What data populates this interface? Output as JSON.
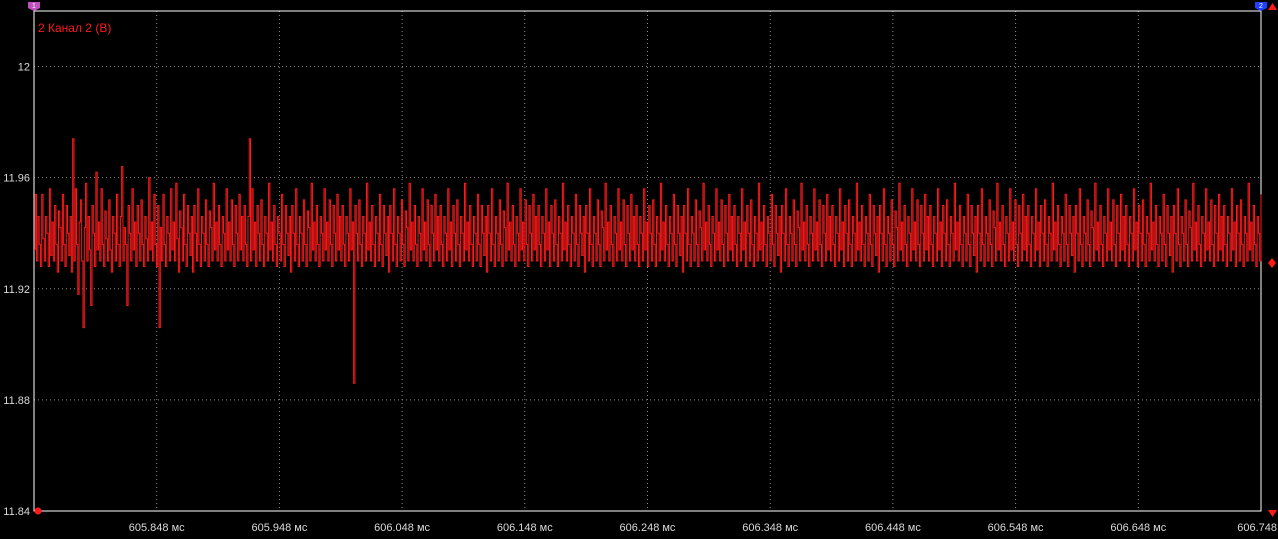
{
  "colors": {
    "background": "#000000",
    "frame": "#ffffff",
    "grid": "#8a8a8a",
    "trace": "#ff1a1a",
    "marker_1": "#c050c0",
    "marker_2": "#2040ff",
    "axis_text": "#d9d9d9"
  },
  "markers": {
    "left_label": "1",
    "right_label": "2",
    "left_icon": "marker-flag-icon",
    "right_icon": "marker-flag-icon",
    "range_up_icon": "triangle-up-icon",
    "range_down_icon": "triangle-down-icon",
    "level_icon": "diamond-icon",
    "zero_icon": "circle-icon"
  },
  "chart_data": {
    "type": "line",
    "title": "2 Канал 2 (В)",
    "xlabel": "",
    "ylabel": "",
    "x_unit": "мс",
    "xlim": [
      605.748,
      606.748
    ],
    "ylim": [
      11.84,
      12.02
    ],
    "grid": true,
    "y_ticks": [
      {
        "value": 11.84,
        "label": "11.84"
      },
      {
        "value": 11.88,
        "label": "11.88"
      },
      {
        "value": 11.92,
        "label": "11.92"
      },
      {
        "value": 11.96,
        "label": "11.96"
      },
      {
        "value": 12.0,
        "label": "12"
      }
    ],
    "x_ticks": [
      {
        "value": 605.848,
        "label": "605.848 мс"
      },
      {
        "value": 605.948,
        "label": "605.948 мс"
      },
      {
        "value": 606.048,
        "label": "606.048 мс"
      },
      {
        "value": 606.148,
        "label": "606.148 мс"
      },
      {
        "value": 606.248,
        "label": "606.248 мс"
      },
      {
        "value": 606.348,
        "label": "606.348 мс"
      },
      {
        "value": 606.448,
        "label": "606.448 мс"
      },
      {
        "value": 606.548,
        "label": "606.548 мс"
      },
      {
        "value": 606.648,
        "label": "606.648 мс"
      },
      {
        "value": 606.748,
        "label": "606.748"
      }
    ],
    "series": [
      {
        "name": "2 Канал 2 (В)",
        "color": "#ff1a1a",
        "x_start": 605.748,
        "x_end": 606.748,
        "quantization_step": 0.002,
        "min": 11.886,
        "max": 11.974,
        "mean": 11.94,
        "values": [
          11.934,
          11.954,
          11.93,
          11.946,
          11.936,
          11.928,
          11.954,
          11.938,
          11.93,
          11.946,
          11.94,
          11.928,
          11.956,
          11.932,
          11.944,
          11.93,
          11.95,
          11.936,
          11.926,
          11.948,
          11.942,
          11.93,
          11.954,
          11.936,
          11.928,
          11.95,
          11.94,
          11.932,
          11.946,
          11.926,
          11.974,
          11.93,
          11.956,
          11.936,
          11.918,
          11.944,
          11.952,
          11.93,
          11.906,
          11.942,
          11.958,
          11.93,
          11.946,
          11.934,
          11.914,
          11.95,
          11.94,
          11.928,
          11.962,
          11.934,
          11.944,
          11.93,
          11.956,
          11.936,
          11.928,
          11.948,
          11.938,
          11.93,
          11.952,
          11.934,
          11.926,
          11.946,
          11.94,
          11.93,
          11.954,
          11.936,
          11.928,
          11.946,
          11.964,
          11.93,
          11.942,
          11.936,
          11.914,
          11.95,
          11.94,
          11.93,
          11.956,
          11.934,
          11.944,
          11.928,
          11.95,
          11.94,
          11.93,
          11.952,
          11.936,
          11.928,
          11.946,
          11.938,
          11.93,
          11.96,
          11.934,
          11.944,
          11.93,
          11.954,
          11.936,
          11.928,
          11.95,
          11.906,
          11.942,
          11.93,
          11.954,
          11.936,
          11.928,
          11.946,
          11.94,
          11.93,
          11.956,
          11.934,
          11.944,
          11.93,
          11.958,
          11.938,
          11.926,
          11.948,
          11.942,
          11.93,
          11.954,
          11.936,
          11.928,
          11.95,
          11.94,
          11.932,
          11.946,
          11.926,
          11.95,
          11.94,
          11.93,
          11.956,
          11.936,
          11.928,
          11.946,
          11.94,
          11.93,
          11.952,
          11.936,
          11.928,
          11.948,
          11.942,
          11.93,
          11.958,
          11.934,
          11.944,
          11.93,
          11.95,
          11.936,
          11.928,
          11.946,
          11.94,
          11.93,
          11.956,
          11.934,
          11.944,
          11.93,
          11.952,
          11.936,
          11.928,
          11.95,
          11.94,
          11.93,
          11.954,
          11.934,
          11.946,
          11.93,
          11.95,
          11.936,
          11.928,
          11.946,
          11.974,
          11.93,
          11.956,
          11.934,
          11.944,
          11.928,
          11.95,
          11.94,
          11.93,
          11.952,
          11.936,
          11.928,
          11.946,
          11.94,
          11.93,
          11.958,
          11.934,
          11.944,
          11.93,
          11.95,
          11.936,
          11.928,
          11.946,
          11.94,
          11.93,
          11.954,
          11.936,
          11.928,
          11.95,
          11.94,
          11.932,
          11.946,
          11.926,
          11.95,
          11.94,
          11.93,
          11.956,
          11.936,
          11.928,
          11.946,
          11.94,
          11.93,
          11.952,
          11.936,
          11.928,
          11.948,
          11.942,
          11.93,
          11.958,
          11.934,
          11.944,
          11.93,
          11.95,
          11.936,
          11.928,
          11.946,
          11.94,
          11.93,
          11.956,
          11.934,
          11.944,
          11.93,
          11.952,
          11.936,
          11.928,
          11.95,
          11.94,
          11.93,
          11.954,
          11.934,
          11.946,
          11.93,
          11.95,
          11.936,
          11.928,
          11.946,
          11.94,
          11.93,
          11.956,
          11.934,
          11.944,
          11.928,
          11.95,
          11.94,
          11.93,
          11.952,
          11.936,
          11.928,
          11.946,
          11.94,
          11.93,
          11.958,
          11.934,
          11.944,
          11.93,
          11.95,
          11.936,
          11.928,
          11.946,
          11.94,
          11.93,
          11.954,
          11.936,
          11.928,
          11.95,
          11.94,
          11.932,
          11.946,
          11.926,
          11.95,
          11.94,
          11.93,
          11.956,
          11.936,
          11.928,
          11.946,
          11.94,
          11.93,
          11.952,
          11.936,
          11.928,
          11.948,
          11.942,
          11.93,
          11.958,
          11.934,
          11.944,
          11.93,
          11.95,
          11.936,
          11.928,
          11.946,
          11.94,
          11.93,
          11.956,
          11.934,
          11.944,
          11.93,
          11.952,
          11.936,
          11.928,
          11.95,
          11.94,
          11.93,
          11.954,
          11.934,
          11.946,
          11.93,
          11.95,
          11.936,
          11.928,
          11.946,
          11.94,
          11.93,
          11.956,
          11.934,
          11.944,
          11.928,
          11.95,
          11.94,
          11.93,
          11.952,
          11.936,
          11.928,
          11.946,
          11.94,
          11.93,
          11.958,
          11.934,
          11.944,
          11.93,
          11.95,
          11.936,
          11.928,
          11.946,
          11.94,
          11.93,
          11.954,
          11.936,
          11.928,
          11.95,
          11.94,
          11.932,
          11.946,
          11.926,
          11.95,
          11.94,
          11.93,
          11.956,
          11.936,
          11.928,
          11.946,
          11.94,
          11.93,
          11.952,
          11.936,
          11.928,
          11.948,
          11.942,
          11.93,
          11.958,
          11.934,
          11.944,
          11.93,
          11.95,
          11.936,
          11.928,
          11.946,
          11.94,
          11.93,
          11.956,
          11.934,
          11.944,
          11.93,
          11.952,
          11.936,
          11.928,
          11.95,
          11.94,
          11.93,
          11.954,
          11.934,
          11.946,
          11.93,
          11.95,
          11.936,
          11.928,
          11.946,
          11.94,
          11.93,
          11.956,
          11.934,
          11.944,
          11.928,
          11.95,
          11.94,
          11.93,
          11.952,
          11.936,
          11.928,
          11.946,
          11.94,
          11.93,
          11.958,
          11.934,
          11.944,
          11.93,
          11.95,
          11.936,
          11.928,
          11.946,
          11.94,
          11.93,
          11.954,
          11.936,
          11.928,
          11.95,
          11.94,
          11.932,
          11.946,
          11.926,
          11.95,
          11.94,
          11.93,
          11.956,
          11.936,
          11.928,
          11.946,
          11.94,
          11.93,
          11.952,
          11.936,
          11.928,
          11.948,
          11.942,
          11.93,
          11.958,
          11.934,
          11.944,
          11.93,
          11.95,
          11.936,
          11.928,
          11.946,
          11.94,
          11.93,
          11.956,
          11.934,
          11.944,
          11.93,
          11.952,
          11.936,
          11.928,
          11.95,
          11.94,
          11.93,
          11.954,
          11.934,
          11.946,
          11.93,
          11.95,
          11.936,
          11.928,
          11.946,
          11.94,
          11.93,
          11.956,
          11.934,
          11.944,
          11.928,
          11.95,
          11.94,
          11.93,
          11.952,
          11.936,
          11.928,
          11.946,
          11.94,
          11.93,
          11.958,
          11.934,
          11.944,
          11.93,
          11.95,
          11.936,
          11.928,
          11.946,
          11.94,
          11.93,
          11.954,
          11.936,
          11.928,
          11.95,
          11.94,
          11.932,
          11.946,
          11.926,
          11.95,
          11.94,
          11.93,
          11.956,
          11.936,
          11.928,
          11.946,
          11.94,
          11.93,
          11.952,
          11.936,
          11.928,
          11.948,
          11.942,
          11.93,
          11.958,
          11.934,
          11.944,
          11.93,
          11.95,
          11.936,
          11.928,
          11.946,
          11.94,
          11.93,
          11.956,
          11.934,
          11.944,
          11.93,
          11.952,
          11.936,
          11.928,
          11.95,
          11.94,
          11.93,
          11.954,
          11.934,
          11.946,
          11.93,
          11.95,
          11.936,
          11.928,
          11.946,
          11.94,
          11.93,
          11.956,
          11.934,
          11.944,
          11.928,
          11.95,
          11.94,
          11.93,
          11.952,
          11.936,
          11.928,
          11.946,
          11.94,
          11.93,
          11.958,
          11.934,
          11.944,
          11.93,
          11.95,
          11.936,
          11.928,
          11.946,
          11.94,
          11.93,
          11.954,
          11.936,
          11.928,
          11.95,
          11.94,
          11.932,
          11.946,
          11.926,
          11.95,
          11.94,
          11.93,
          11.956,
          11.936,
          11.928,
          11.946,
          11.94,
          11.93,
          11.952,
          11.936,
          11.928,
          11.948,
          11.942,
          11.93,
          11.958,
          11.934,
          11.944,
          11.93,
          11.95,
          11.936,
          11.928,
          11.946,
          11.94,
          11.93,
          11.956,
          11.934,
          11.944,
          11.93,
          11.952,
          11.936,
          11.928,
          11.95,
          11.94,
          11.93,
          11.954,
          11.934,
          11.946,
          11.93,
          11.95,
          11.936,
          11.928,
          11.946,
          11.94,
          11.93,
          11.956,
          11.934,
          11.944,
          11.928,
          11.95,
          11.94,
          11.93,
          11.952,
          11.936,
          11.928,
          11.946,
          11.94,
          11.93,
          11.958,
          11.934,
          11.944,
          11.93,
          11.95,
          11.936,
          11.928,
          11.946,
          11.94,
          11.93,
          11.954,
          11.936,
          11.928,
          11.95,
          11.94,
          11.932,
          11.946,
          11.926,
          11.95,
          11.94,
          11.93,
          11.956,
          11.936,
          11.928,
          11.946,
          11.94,
          11.93,
          11.952,
          11.936,
          11.928,
          11.948,
          11.942,
          11.93,
          11.958,
          11.934,
          11.944,
          11.93,
          11.95,
          11.936,
          11.928,
          11.946,
          11.94,
          11.93,
          11.956,
          11.934,
          11.944,
          11.93,
          11.952,
          11.936,
          11.928,
          11.95,
          11.94,
          11.93,
          11.954,
          11.934,
          11.946,
          11.93,
          11.95,
          11.936,
          11.928,
          11.946,
          11.94,
          11.93,
          11.956,
          11.934,
          11.944,
          11.928,
          11.95,
          11.94,
          11.93,
          11.952,
          11.936,
          11.928,
          11.946,
          11.94,
          11.93,
          11.958,
          11.934,
          11.944,
          11.93,
          11.95,
          11.936,
          11.928,
          11.946,
          11.94,
          11.93,
          11.954,
          11.936,
          11.928,
          11.95,
          11.94,
          11.932,
          11.946,
          11.926,
          11.95,
          11.94,
          11.93,
          11.956,
          11.936,
          11.928,
          11.946,
          11.94,
          11.93,
          11.952,
          11.936,
          11.928,
          11.948,
          11.942,
          11.93,
          11.958,
          11.934,
          11.944,
          11.93,
          11.95,
          11.936,
          11.928,
          11.946,
          11.94,
          11.93,
          11.956,
          11.934,
          11.944,
          11.93,
          11.952,
          11.936,
          11.928,
          11.95,
          11.94,
          11.93,
          11.954,
          11.934,
          11.946,
          11.93,
          11.95,
          11.936,
          11.928,
          11.946,
          11.94,
          11.93,
          11.956,
          11.934,
          11.944,
          11.928,
          11.95,
          11.94,
          11.93,
          11.952,
          11.936,
          11.928,
          11.946,
          11.94,
          11.93,
          11.958,
          11.934,
          11.944,
          11.93,
          11.95,
          11.936,
          11.928,
          11.946,
          11.94,
          11.93,
          11.954,
          11.936,
          11.928,
          11.95,
          11.94,
          11.932,
          11.946,
          11.926,
          11.95,
          11.94,
          11.93,
          11.956,
          11.936,
          11.928,
          11.946,
          11.94,
          11.93,
          11.952,
          11.936,
          11.928,
          11.948,
          11.942,
          11.93,
          11.958,
          11.934,
          11.944,
          11.93,
          11.95,
          11.936,
          11.928,
          11.946,
          11.94,
          11.93,
          11.956,
          11.934,
          11.944,
          11.93,
          11.952,
          11.936,
          11.928,
          11.95,
          11.94,
          11.93,
          11.954,
          11.934,
          11.946,
          11.93,
          11.95,
          11.936,
          11.928,
          11.946,
          11.94,
          11.93,
          11.956,
          11.934,
          11.944,
          11.928,
          11.95,
          11.94,
          11.93,
          11.952,
          11.936,
          11.928,
          11.946,
          11.94,
          11.93,
          11.958,
          11.934,
          11.944,
          11.93,
          11.95,
          11.936,
          11.928,
          11.946,
          11.94,
          11.93,
          11.954,
          11.936,
          11.928,
          11.95,
          11.94,
          11.932,
          11.946,
          11.926,
          11.95,
          11.94,
          11.93,
          11.956,
          11.936,
          11.928,
          11.946,
          11.94,
          11.93,
          11.952,
          11.936,
          11.928,
          11.948,
          11.942,
          11.93,
          11.958,
          11.934,
          11.944,
          11.93,
          11.95,
          11.936,
          11.928,
          11.946,
          11.94,
          11.93,
          11.956,
          11.934,
          11.944,
          11.93,
          11.952,
          11.936,
          11.928,
          11.95,
          11.94,
          11.93,
          11.954,
          11.934,
          11.946,
          11.93,
          11.95,
          11.936,
          11.928,
          11.946,
          11.94,
          11.93,
          11.956,
          11.934,
          11.944,
          11.928,
          11.95,
          11.94,
          11.93,
          11.952,
          11.936,
          11.928,
          11.946,
          11.94,
          11.93,
          11.958,
          11.934,
          11.944,
          11.93,
          11.95,
          11.936,
          11.928,
          11.946,
          11.94,
          11.93,
          11.954
        ]
      }
    ],
    "annotations": [
      {
        "x": 606.008,
        "y": 11.886,
        "label": ""
      }
    ]
  }
}
